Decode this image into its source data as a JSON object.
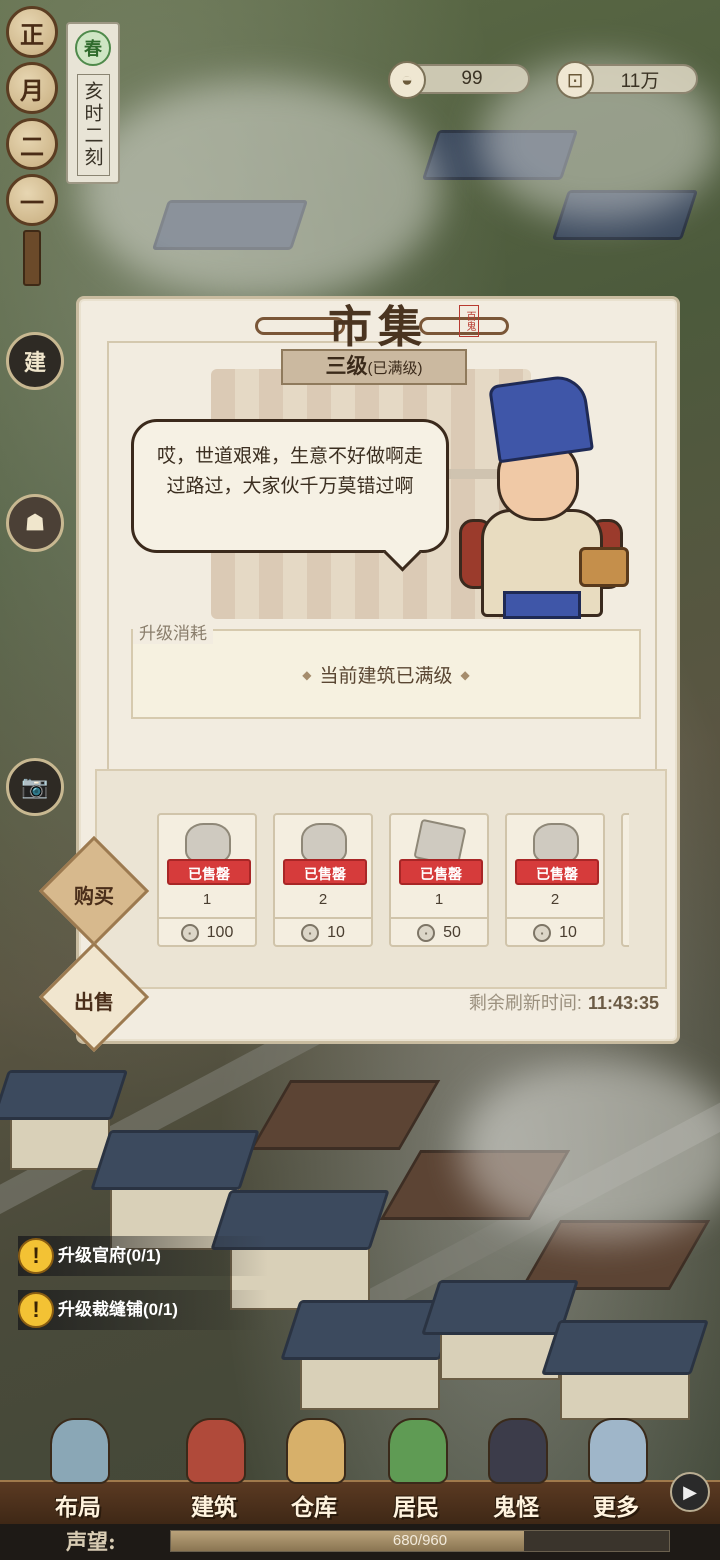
{
  "hud": {
    "date_chars": [
      "正",
      "月",
      "二",
      "一"
    ],
    "season": "春",
    "time": "亥时二刻",
    "resources": [
      {
        "icon": "silver-ingot-icon",
        "value": "99"
      },
      {
        "icon": "copper-coin-icon",
        "value": "11万"
      }
    ],
    "side_buttons": [
      {
        "name": "build-mode-button",
        "glyph": "建"
      },
      {
        "name": "camera-button",
        "glyph": "📷"
      }
    ]
  },
  "dialog": {
    "title": "市集",
    "seal": "百鬼",
    "level": "三级",
    "level_note": "(已满级)",
    "speech": "哎，世道艰难，生意不好做啊走过路过，大家伙千万莫错过啊",
    "cost_label": "升级消耗",
    "cost_text": "当前建筑已满级",
    "tabs": [
      {
        "label": "购买",
        "active": true
      },
      {
        "label": "出售",
        "active": false
      }
    ],
    "items": [
      {
        "status": "已售罄",
        "qty": "1",
        "price": "100"
      },
      {
        "status": "已售罄",
        "qty": "2",
        "price": "10"
      },
      {
        "status": "已售罄",
        "qty": "1",
        "price": "50"
      },
      {
        "status": "已售罄",
        "qty": "2",
        "price": "10"
      }
    ],
    "refresh_label": "剩余刷新时间:",
    "refresh_time": "11:43:35"
  },
  "quests": [
    {
      "label": "升级官府(0/1)"
    },
    {
      "label": "升级裁缝铺(0/1)"
    }
  ],
  "nav": {
    "items": [
      {
        "label": "布局",
        "color": "#8aa7b6"
      },
      {
        "label": "建筑",
        "color": "#b04a3a"
      },
      {
        "label": "仓库",
        "color": "#d7b06a"
      },
      {
        "label": "居民",
        "color": "#5f9b54"
      },
      {
        "label": "鬼怪",
        "color": "#3c3c4a"
      },
      {
        "label": "更多",
        "color": "#9fb6c9"
      }
    ],
    "reputation_label": "声望:",
    "reputation_value": "680/960",
    "reputation_fraction": 0.708
  },
  "colors": {
    "sold_out_red": "#d63b3b",
    "quest_yellow": "#f3c234",
    "panel_bg": "#f2ece0"
  }
}
